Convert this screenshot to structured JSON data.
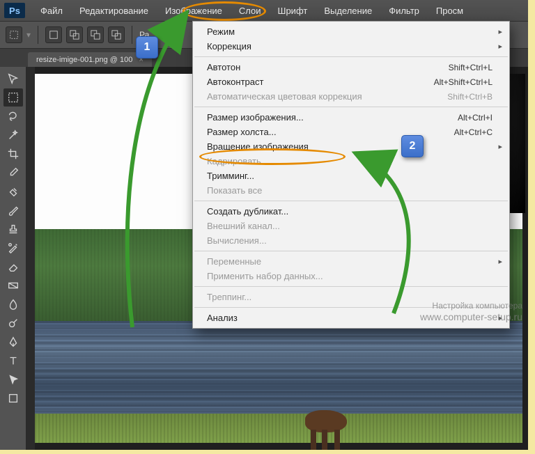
{
  "app": {
    "logo": "Ps"
  },
  "menubar": [
    "Файл",
    "Редактирование",
    "Изображение",
    "Слои",
    "Шрифт",
    "Выделение",
    "Фильтр",
    "Просм"
  ],
  "optionsbar": {
    "label_fragment": "Ра"
  },
  "tab": {
    "title": "resize-imige-001.png @ 100"
  },
  "callouts": {
    "one": "1",
    "two": "2"
  },
  "watermark": {
    "line1": "Настройка компьютера",
    "line2": "www.computer-setup.ru"
  },
  "dropdown": {
    "sections": [
      {
        "items": [
          {
            "label": "Режим",
            "submenu": true
          },
          {
            "label": "Коррекция",
            "submenu": true
          }
        ]
      },
      {
        "items": [
          {
            "label": "Автотон",
            "shortcut": "Shift+Ctrl+L"
          },
          {
            "label": "Автоконтраст",
            "shortcut": "Alt+Shift+Ctrl+L"
          },
          {
            "label": "Автоматическая цветовая коррекция",
            "shortcut": "Shift+Ctrl+B",
            "disabled": true
          }
        ]
      },
      {
        "items": [
          {
            "label": "Размер изображения...",
            "shortcut": "Alt+Ctrl+I",
            "highlight": true
          },
          {
            "label": "Размер холста...",
            "shortcut": "Alt+Ctrl+C"
          },
          {
            "label": "Вращение изображения",
            "submenu": true
          },
          {
            "label": "Кадрировать",
            "disabled": true
          },
          {
            "label": "Тримминг..."
          },
          {
            "label": "Показать все",
            "disabled": true
          }
        ]
      },
      {
        "items": [
          {
            "label": "Создать дубликат..."
          },
          {
            "label": "Внешний канал...",
            "disabled": true
          },
          {
            "label": "Вычисления...",
            "disabled": true
          }
        ]
      },
      {
        "items": [
          {
            "label": "Переменные",
            "submenu": true,
            "disabled": true
          },
          {
            "label": "Применить набор данных...",
            "disabled": true
          }
        ]
      },
      {
        "items": [
          {
            "label": "Треппинг...",
            "disabled": true
          }
        ]
      },
      {
        "items": [
          {
            "label": "Анализ",
            "submenu": true
          }
        ]
      }
    ]
  },
  "tools": [
    "move",
    "marquee",
    "lasso",
    "wand",
    "crop",
    "eyedropper",
    "heal",
    "brush",
    "stamp",
    "history",
    "eraser",
    "gradient",
    "blur",
    "dodge",
    "pen",
    "type",
    "path",
    "shape"
  ]
}
